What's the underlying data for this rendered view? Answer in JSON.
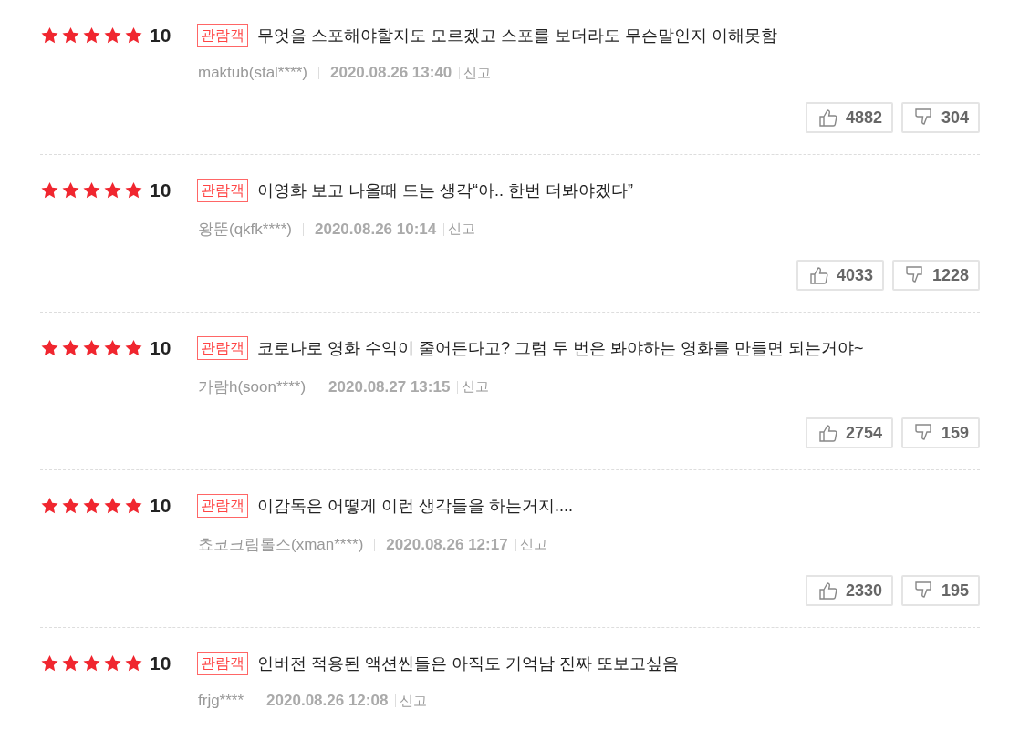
{
  "reviews": [
    {
      "stars": 5,
      "score": "10",
      "badge": "관람객",
      "text": "무엇을 스포해야할지도 모르겠고 스포를 보더라도 무슨말인지 이해못함",
      "author": "maktub(stal****)",
      "date": "2020.08.26 13:40",
      "report": "신고",
      "likes": "4882",
      "dislikes": "304"
    },
    {
      "stars": 5,
      "score": "10",
      "badge": "관람객",
      "text": "이영화 보고 나올때 드는 생각“아.. 한번 더봐야겠다”",
      "author": "왕뚠(qkfk****)",
      "date": "2020.08.26 10:14",
      "report": "신고",
      "likes": "4033",
      "dislikes": "1228"
    },
    {
      "stars": 5,
      "score": "10",
      "badge": "관람객",
      "text": "코로나로 영화 수익이 줄어든다고? 그럼 두 번은 봐야하는 영화를 만들면 되는거야~",
      "author": "가람h(soon****)",
      "date": "2020.08.27 13:15",
      "report": "신고",
      "likes": "2754",
      "dislikes": "159"
    },
    {
      "stars": 5,
      "score": "10",
      "badge": "관람객",
      "text": "이감독은 어떻게 이런 생각들을 하는거지....",
      "author": "쵸코크림롤스(xman****)",
      "date": "2020.08.26 12:17",
      "report": "신고",
      "likes": "2330",
      "dislikes": "195"
    },
    {
      "stars": 5,
      "score": "10",
      "badge": "관람객",
      "text": "인버전 적용된 액션씬들은 아직도 기억남 진짜 또보고싶음",
      "author": "frjg****",
      "date": "2020.08.26 12:08",
      "report": "신고"
    }
  ]
}
